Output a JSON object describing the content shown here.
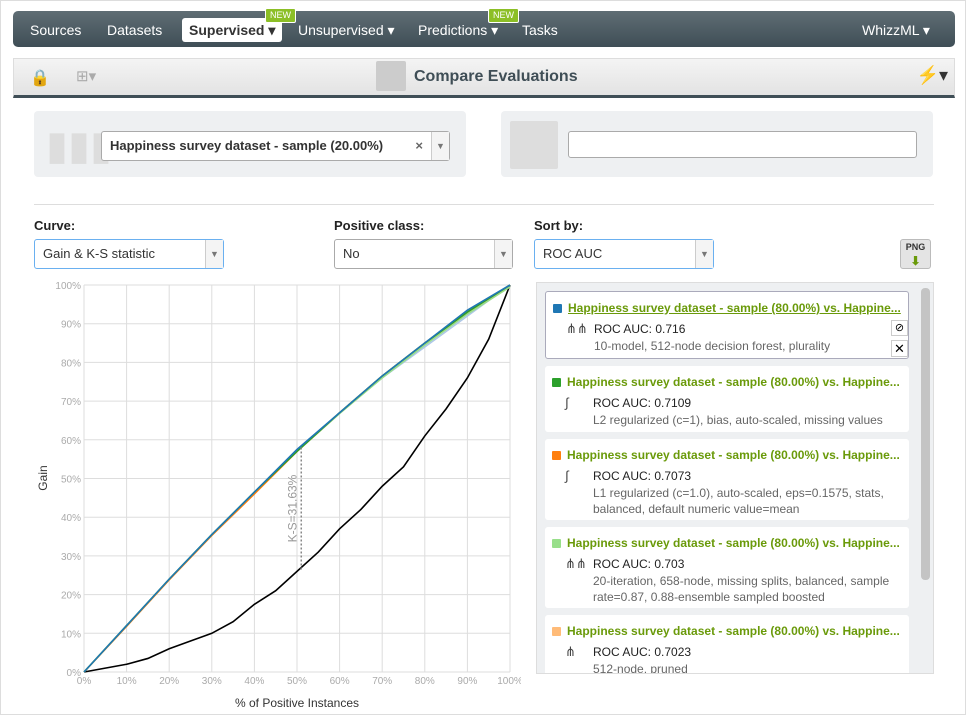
{
  "nav": {
    "items": [
      {
        "label": "Sources"
      },
      {
        "label": "Datasets"
      },
      {
        "label": "Supervised",
        "badge": "NEW",
        "active": true
      },
      {
        "label": "Unsupervised"
      },
      {
        "label": "Predictions",
        "badge": "NEW"
      },
      {
        "label": "Tasks"
      }
    ],
    "right": "WhizzML"
  },
  "toolbar": {
    "title": "Compare Evaluations"
  },
  "left_panel": {
    "dataset": "Happiness survey dataset - sample (20.00%)"
  },
  "right_panel": {
    "input_value": ""
  },
  "controls": {
    "curve_label": "Curve:",
    "curve_value": "Gain & K-S statistic",
    "positive_label": "Positive class:",
    "positive_value": "No",
    "sort_label": "Sort by:",
    "sort_value": "ROC AUC",
    "png": "PNG"
  },
  "evaluations": [
    {
      "title": "Happiness survey dataset - sample (80.00%) vs. Happine...",
      "metric": "ROC AUC: 0.716",
      "desc": "10-model, 512-node decision forest, plurality",
      "color": "#1f77b4",
      "icon": "ensemble-icon"
    },
    {
      "title": "Happiness survey dataset - sample (80.00%) vs. Happine...",
      "metric": "ROC AUC: 0.7109",
      "desc": "L2 regularized (c=1), bias, auto-scaled, missing values",
      "color": "#2ca02c",
      "icon": "logistic-icon"
    },
    {
      "title": "Happiness survey dataset - sample (80.00%) vs. Happine...",
      "metric": "ROC AUC: 0.7073",
      "desc": "L1 regularized (c=1.0), auto-scaled, eps=0.1575, stats, balanced, default numeric value=mean",
      "color": "#ff7f0e",
      "icon": "logistic-icon"
    },
    {
      "title": "Happiness survey dataset - sample (80.00%) vs. Happine...",
      "metric": "ROC AUC: 0.703",
      "desc": "20-iteration, 658-node, missing splits, balanced, sample rate=0.87, 0.88-ensemble sampled boosted",
      "color": "#98df8a",
      "icon": "ensemble-icon"
    },
    {
      "title": "Happiness survey dataset - sample (80.00%) vs. Happine...",
      "metric": "ROC AUC: 0.7023",
      "desc": "512-node, pruned",
      "color": "#ffbb78",
      "icon": "model-icon"
    }
  ],
  "chart_data": {
    "type": "line",
    "xlabel": "% of Positive Instances",
    "ylabel": "Gain",
    "xlim": [
      0,
      100
    ],
    "ylim": [
      0,
      100
    ],
    "grid": true,
    "ticks": [
      "0%",
      "10%",
      "20%",
      "30%",
      "40%",
      "50%",
      "60%",
      "70%",
      "80%",
      "90%",
      "100%"
    ],
    "x": [
      0,
      10,
      20,
      30,
      40,
      50,
      60,
      70,
      80,
      90,
      100
    ],
    "series": [
      {
        "color": "#1f77b4",
        "values": [
          0,
          12,
          24,
          35.5,
          46.5,
          57.5,
          67,
          76.5,
          85,
          93.5,
          100
        ]
      },
      {
        "color": "#2ca02c",
        "values": [
          0,
          12,
          24,
          35.5,
          46.5,
          57,
          67,
          76.5,
          85,
          93,
          100
        ]
      },
      {
        "color": "#ff7f0e",
        "values": [
          0,
          11.8,
          23.8,
          35.3,
          46,
          57,
          67,
          76.5,
          85,
          93,
          100
        ]
      },
      {
        "color": "#98df8a",
        "values": [
          0,
          12,
          24,
          35.5,
          46.5,
          57,
          66.8,
          76,
          84.5,
          92.5,
          99.5
        ]
      },
      {
        "color": "#aec7e8",
        "values": [
          0,
          12,
          24,
          35.5,
          46.5,
          57.5,
          67,
          76,
          84,
          92,
          100
        ]
      }
    ],
    "baseline": {
      "color": "#000000",
      "x": [
        0,
        5,
        10,
        15,
        20,
        25,
        30,
        35,
        40,
        45,
        50,
        55,
        60,
        65,
        70,
        75,
        80,
        85,
        90,
        95,
        100
      ],
      "values": [
        0,
        1,
        2,
        3.5,
        6,
        8,
        10,
        13,
        17.5,
        21,
        26,
        31,
        37,
        42,
        48,
        53,
        61,
        68,
        76,
        86,
        100
      ]
    },
    "ks": {
      "label": "K-S=31.63%",
      "x": 51,
      "from": 26.5,
      "to": 58
    }
  }
}
